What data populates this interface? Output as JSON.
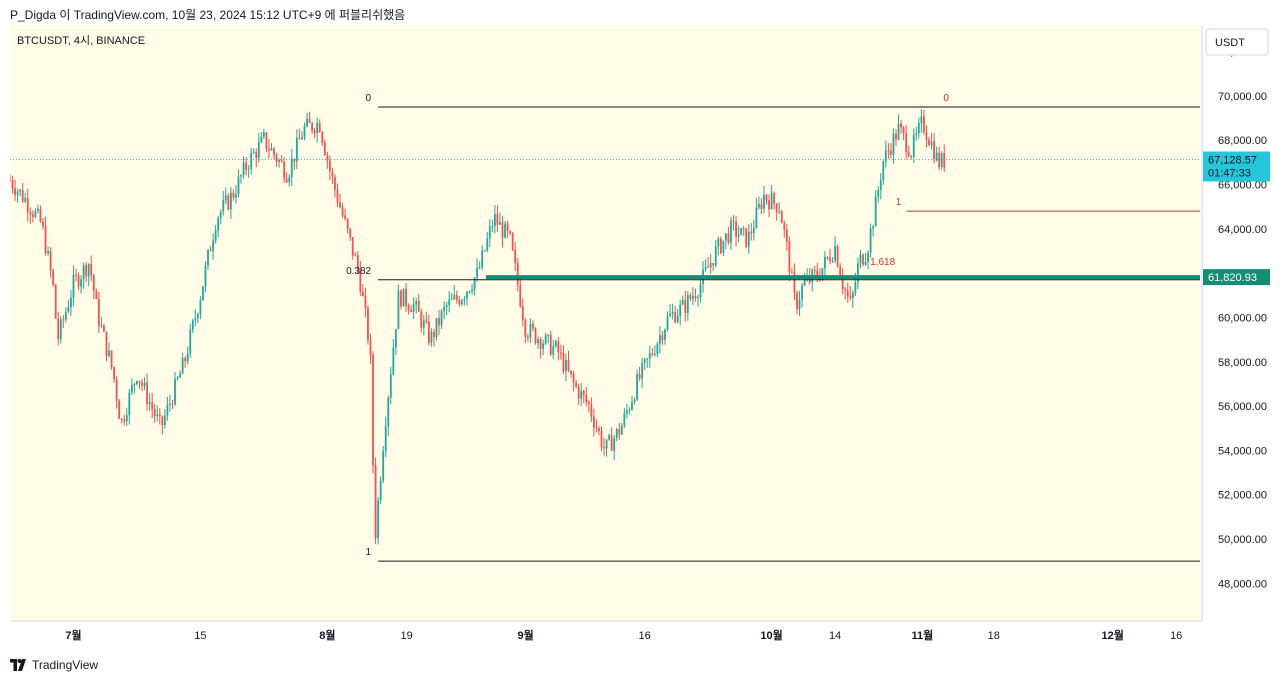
{
  "header": {
    "attribution": "P_Digda 이 TradingView.com, 10월 23, 2024 15:12 UTC+9 에 퍼블리쉬했음"
  },
  "symbol": {
    "text": "BTCUSDT, 4시, BINANCE"
  },
  "currency": {
    "label": "USDT"
  },
  "footer": {
    "brand": "TradingView"
  },
  "chart_data": {
    "type": "candlestick",
    "title": "BTCUSDT, 4시, BINANCE",
    "x_ticks": [
      {
        "label": "7월",
        "t": 6.0,
        "bold": true
      },
      {
        "label": "15",
        "t": 14.0,
        "bold": false
      },
      {
        "label": "8월",
        "t": 22.0,
        "bold": true
      },
      {
        "label": "19",
        "t": 27.0,
        "bold": false
      },
      {
        "label": "9월",
        "t": 34.5,
        "bold": true
      },
      {
        "label": "16",
        "t": 42.0,
        "bold": false
      },
      {
        "label": "10월",
        "t": 50.0,
        "bold": true
      },
      {
        "label": "14",
        "t": 54.0,
        "bold": false
      },
      {
        "label": "11월",
        "t": 59.5,
        "bold": true
      },
      {
        "label": "18",
        "t": 64.0,
        "bold": false
      },
      {
        "label": "12월",
        "t": 71.5,
        "bold": true
      },
      {
        "label": "16",
        "t": 75.5,
        "bold": false
      }
    ],
    "y_ticks": [
      48000,
      50000,
      52000,
      54000,
      56000,
      58000,
      60000,
      62000,
      64000,
      66000,
      68000,
      70000,
      72000
    ],
    "y_tick_labels": [
      "48,000.00",
      "50,000.00",
      "52,000.00",
      "54,000.00",
      "56,000.00",
      "58,000.00",
      "60,000.00",
      "62,000.00",
      "64,000.00",
      "66,000.00",
      "68,000.00",
      "70,000.00",
      "72,000.00"
    ],
    "x_range": [
      2.0,
      77.0
    ],
    "y_range": [
      46300,
      73200
    ],
    "price_path": [
      [
        2.0,
        66200
      ],
      [
        3.0,
        65300
      ],
      [
        4.0,
        64200
      ],
      [
        4.7,
        61500
      ],
      [
        5.0,
        59000
      ],
      [
        6.0,
        61500
      ],
      [
        7.0,
        62500
      ],
      [
        7.5,
        60200
      ],
      [
        8.5,
        57500
      ],
      [
        9.0,
        55200
      ],
      [
        10.0,
        57500
      ],
      [
        11.5,
        55000
      ],
      [
        13.0,
        58000
      ],
      [
        14.0,
        61000
      ],
      [
        15.0,
        64500
      ],
      [
        16.0,
        65500
      ],
      [
        17.0,
        67000
      ],
      [
        18.0,
        68000
      ],
      [
        19.5,
        66500
      ],
      [
        20.5,
        68500
      ],
      [
        21.5,
        68800
      ],
      [
        22.2,
        66500
      ],
      [
        23.0,
        64500
      ],
      [
        24.0,
        62000
      ],
      [
        24.7,
        58500
      ],
      [
        25.0,
        50000
      ],
      [
        25.6,
        55000
      ],
      [
        26.5,
        61000
      ],
      [
        27.5,
        60500
      ],
      [
        28.5,
        59000
      ],
      [
        29.5,
        60500
      ],
      [
        30.5,
        61000
      ],
      [
        31.5,
        62000
      ],
      [
        32.5,
        64500
      ],
      [
        33.5,
        63500
      ],
      [
        34.0,
        61500
      ],
      [
        34.5,
        59500
      ],
      [
        35.5,
        59000
      ],
      [
        36.5,
        58500
      ],
      [
        37.5,
        57000
      ],
      [
        38.5,
        56000
      ],
      [
        39.5,
        54000
      ],
      [
        40.5,
        55000
      ],
      [
        41.5,
        57000
      ],
      [
        42.5,
        58500
      ],
      [
        43.5,
        60000
      ],
      [
        44.5,
        60500
      ],
      [
        45.5,
        61500
      ],
      [
        46.5,
        63000
      ],
      [
        47.5,
        64000
      ],
      [
        48.5,
        63500
      ],
      [
        49.5,
        65500
      ],
      [
        50.5,
        65000
      ],
      [
        51.0,
        63000
      ],
      [
        51.5,
        60500
      ],
      [
        52.0,
        61500
      ],
      [
        53.0,
        62000
      ],
      [
        54.0,
        63200
      ],
      [
        54.5,
        61500
      ],
      [
        55.0,
        60500
      ],
      [
        55.5,
        62500
      ],
      [
        56.0,
        63000
      ],
      [
        56.5,
        64800
      ],
      [
        57.0,
        67000
      ],
      [
        58.0,
        68500
      ],
      [
        58.8,
        67500
      ],
      [
        59.5,
        68800
      ],
      [
        60.0,
        68000
      ],
      [
        60.5,
        67000
      ],
      [
        61.0,
        67100
      ]
    ],
    "series_colors": {
      "up": "#26a69a",
      "down": "#ef5350"
    },
    "current_price": {
      "value": 67128.57,
      "label": "67,128.57",
      "countdown": "01:47:33",
      "color": "#26c6da"
    },
    "support_line": {
      "value": 61820.93,
      "label": "61,820.93",
      "color": "#138d75",
      "t_start": 32.0
    },
    "fib_levels": [
      {
        "level": "0",
        "price": 69500,
        "t_start": 25.2,
        "color": "#131722"
      },
      {
        "level": "0.382",
        "price": 61700,
        "t_start": 25.2,
        "color": "#131722"
      },
      {
        "level": "1",
        "price": 49000,
        "t_start": 25.2,
        "color": "#131722"
      }
    ],
    "fib_ext": [
      {
        "level": "0",
        "price": 69500,
        "t": 61.0,
        "color": "#c0392b"
      },
      {
        "level": "1",
        "price": 64800,
        "t": 58.0,
        "color": "#c0392b"
      },
      {
        "level": "1.618",
        "price": 62100,
        "t": 57.0,
        "color": "#c0392b"
      }
    ],
    "ext_line": {
      "price": 64800,
      "t_start": 58.5,
      "color": "#c0392b"
    },
    "grid": false,
    "background": "#fefbe6"
  }
}
